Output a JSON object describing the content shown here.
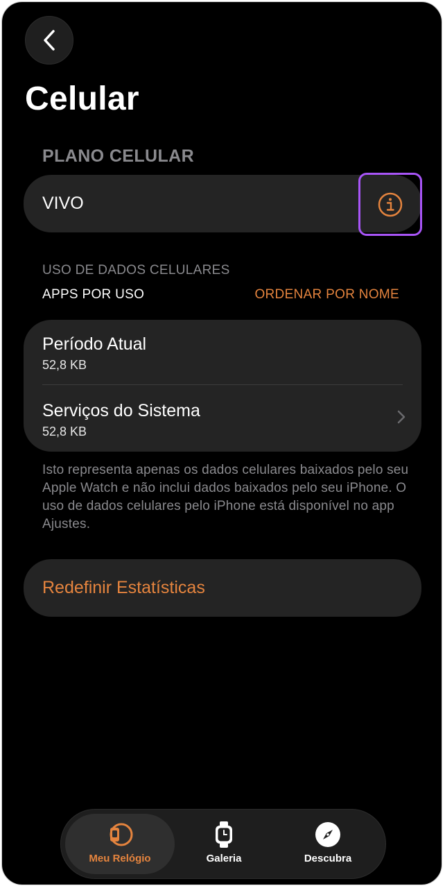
{
  "colors": {
    "accent": "#e5843e",
    "highlight": "#a855f7",
    "background": "#000000",
    "card": "#242424"
  },
  "nav": {
    "back_icon": "chevron-left-icon"
  },
  "page": {
    "title": "Celular"
  },
  "plan_section": {
    "header": "PLANO CELULAR",
    "carrier": "VIVO",
    "info_icon": "info-circle-icon"
  },
  "usage_section": {
    "header": "USO DE DADOS CELULARES",
    "apps_label": "APPS POR USO",
    "sort_label": "ORDENAR POR NOME",
    "rows": [
      {
        "title": "Período Atual",
        "value": "52,8 KB"
      },
      {
        "title": "Serviços do Sistema",
        "value": "52,8 KB"
      }
    ],
    "footnote": "Isto representa apenas os dados celulares baixados pelo seu Apple Watch e não inclui dados baixados pelo seu iPhone. O uso de dados celulares pelo iPhone está disponível no app Ajustes."
  },
  "reset": {
    "label": "Redefinir Estatísticas"
  },
  "tabbar": {
    "tabs": [
      {
        "label": "Meu Relógio",
        "icon": "my-watch-icon",
        "active": true
      },
      {
        "label": "Galeria",
        "icon": "watch-face-icon",
        "active": false
      },
      {
        "label": "Descubra",
        "icon": "compass-icon",
        "active": false
      }
    ]
  }
}
